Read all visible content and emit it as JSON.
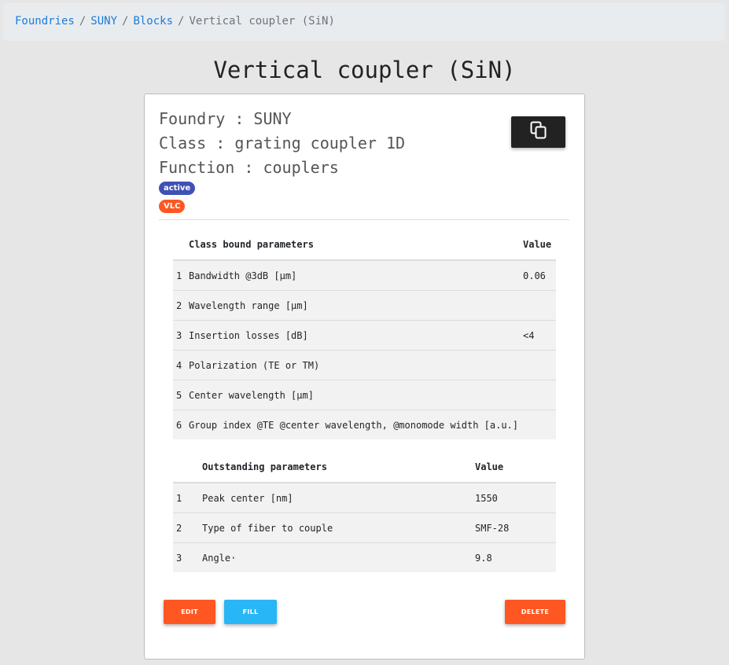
{
  "breadcrumb": {
    "items": [
      "Foundries",
      "SUNY",
      "Blocks"
    ],
    "current": "Vertical coupler (SiN)",
    "separator": "/"
  },
  "page_title": "Vertical coupler (SiN)",
  "info": {
    "foundry": "Foundry : SUNY",
    "class": "Class : grating coupler 1D",
    "function": "Function : couplers"
  },
  "badges": {
    "active": "active",
    "vlc": "VLC"
  },
  "copy_button_icon": "copy-icon",
  "class_params": {
    "header_name": "Class bound parameters",
    "header_value": "Value",
    "rows": [
      {
        "idx": "1",
        "name": "Bandwidth @3dB [µm]",
        "value": "0.06"
      },
      {
        "idx": "2",
        "name": "Wavelength range [µm]",
        "value": ""
      },
      {
        "idx": "3",
        "name": "Insertion losses [dB]",
        "value": "<4"
      },
      {
        "idx": "4",
        "name": "Polarization (TE or TM)",
        "value": ""
      },
      {
        "idx": "5",
        "name": "Center wavelength [µm]",
        "value": ""
      },
      {
        "idx": "6",
        "name": "Group index @TE @center wavelength, @monomode width [a.u.]",
        "value": ""
      }
    ]
  },
  "outstanding_params": {
    "header_name": "Outstanding parameters",
    "header_value": "Value",
    "rows": [
      {
        "idx": "1",
        "name": "Peak center [nm]",
        "value": "1550"
      },
      {
        "idx": "2",
        "name": "Type of fiber to couple",
        "value": "SMF-28"
      },
      {
        "idx": "3",
        "name": "Angle·",
        "value": "9.8"
      }
    ]
  },
  "buttons": {
    "edit": "EDIT",
    "fill": "FILL",
    "delete": "DELETE"
  },
  "colors": {
    "link": "#1a7cd8",
    "badge_active": "#3f51b5",
    "accent_orange": "#ff5722",
    "fill_blue": "#29b6f6",
    "copy_button": "#222222"
  }
}
